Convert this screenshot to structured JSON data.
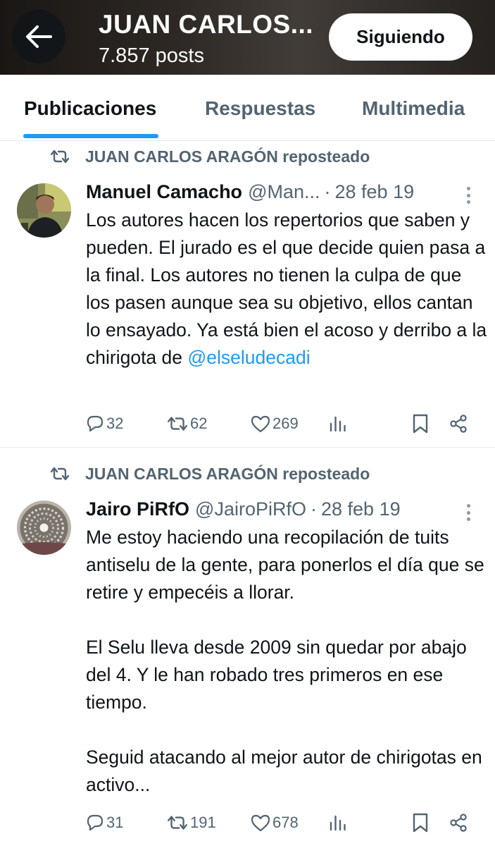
{
  "header": {
    "name": "JUAN CARLOS...",
    "posts_count": "7.857 posts",
    "follow_label": "Siguiendo"
  },
  "tabs": [
    {
      "label": "Publicaciones",
      "active": true
    },
    {
      "label": "Respuestas",
      "active": false
    },
    {
      "label": "Multimedia",
      "active": false
    }
  ],
  "posts": [
    {
      "repost_label": "JUAN CARLOS ARAGÓN reposteado",
      "author": "Manuel Camacho",
      "handle": "@Man...",
      "separator": "·",
      "date": "28 feb 19",
      "text": "Los autores hacen los repertorios que saben y pueden. El jurado es el que decide quien pasa a la final. Los autores no tienen la culpa de que los pasen aunque sea su objetivo, ellos cantan lo ensayado. Ya está bien el acoso y derribo a la chirigota de ",
      "mention": "@elseludecadi",
      "replies": "32",
      "reposts": "62",
      "likes": "269"
    },
    {
      "repost_label": "JUAN CARLOS ARAGÓN reposteado",
      "author": "Jairo PiRfO",
      "handle": "@JairoPiRfO",
      "separator": "·",
      "date": "28 feb 19",
      "text": "Me estoy haciendo una recopilación de tuits antiselu de la gente, para ponerlos el día que se retire y empecéis a llorar.\n\nEl Selu lleva desde 2009 sin quedar por abajo del 4. Y le han robado tres primeros en ese tiempo.\n\nSeguid atacando al mejor autor de chirigotas en activo...",
      "replies": "31",
      "reposts": "191",
      "likes": "678"
    }
  ],
  "colors": {
    "accent": "#1d9bf0",
    "secondary_text": "#536471",
    "primary_text": "#0f1419"
  },
  "icons": [
    "back-arrow-icon",
    "retweet-icon",
    "more-icon",
    "reply-icon",
    "like-icon",
    "views-icon",
    "bookmark-icon",
    "share-icon"
  ]
}
